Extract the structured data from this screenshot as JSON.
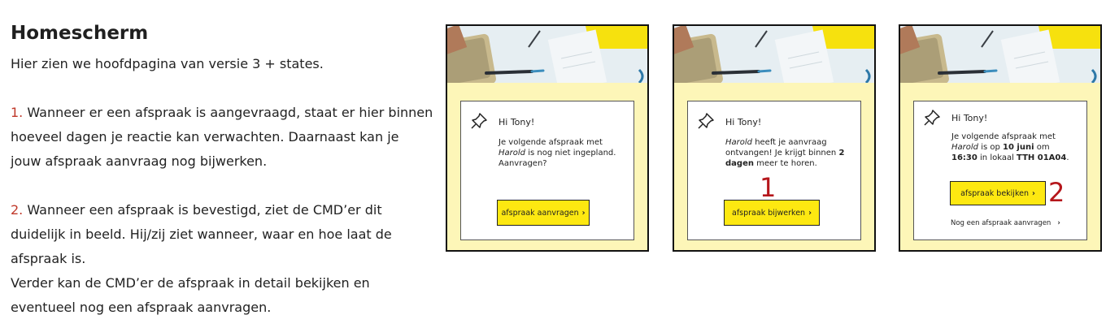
{
  "section": {
    "title": "Homescherm",
    "subtitle": "Hier zien we hoofdpagina van versie 3 + states.",
    "item1_number": "1.",
    "item1_text": " Wanneer er een afspraak is aangevraagd, staat er hier binnen hoeveel dagen je reactie kan verwachten. Daarnaast kan je jouw afspraak aanvraag nog bijwerken.",
    "item2_number": "2.",
    "item2_text": " Wanneer een afspraak is bevestigd, ziet de CMD’er dit duidelijk in beeld. Hij/zij ziet wanneer, waar en hoe laat de afspraak is.",
    "item2_extra": "Verder kan de CMD’er de afspraak in detail bekijken en eventueel nog een afspraak aanvragen."
  },
  "screens": [
    {
      "greeting": "Hi Tony!",
      "line1": "Je volgende afspraak met",
      "name": "Harold",
      "line2": " is nog niet ingepland.",
      "line3": "Aanvragen?",
      "button": "afspraak aanvragen",
      "chevron": "›"
    },
    {
      "greeting": "Hi Tony!",
      "name": "Harold",
      "line1": " heeft je aanvraag ontvangen! Je krijgt binnen ",
      "bold1": "2 dagen",
      "line2": " meer te horen.",
      "button": "afspraak bijwerken",
      "chevron": "›",
      "marker": "1"
    },
    {
      "greeting": "Hi Tony!",
      "line1": "Je volgende afspraak met",
      "name": "Harold",
      "line2": " is op ",
      "date": "10 juni",
      "line3": " om",
      "time": "16:30",
      "line4": " in lokaal ",
      "room": "TTH 01A04",
      "line5": ".",
      "button": "afspraak bekijken",
      "chevron": "›",
      "marker": "2",
      "link": "Nog een afspraak aanvragen"
    }
  ],
  "colors": {
    "accent_yellow": "#fde811",
    "screen_bg": "#fdf6b8",
    "marker_red": "#b5161b",
    "number_red": "#c0392b"
  }
}
